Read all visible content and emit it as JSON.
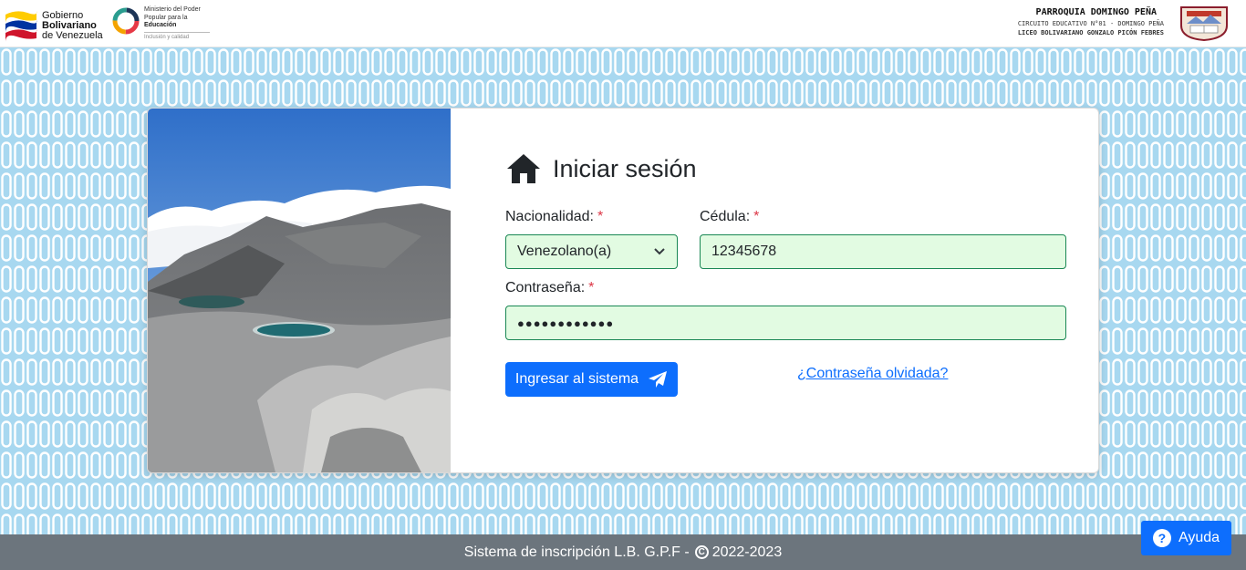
{
  "header": {
    "gov_logo": {
      "line1": "Gobierno",
      "line2": "Bolivariano",
      "line3": "de Venezuela",
      "flag_colors": [
        "#ffcc00",
        "#0033a0",
        "#cf142b"
      ]
    },
    "ministry_logo": {
      "line1": "Ministerio del Poder",
      "line2": "Popular para la",
      "line3": "Educación",
      "tagline": "Inclusión y calidad"
    },
    "school": {
      "parroquia": "PARROQUIA DOMINGO PEÑA",
      "circuito": "CIRCUITO EDUCATIVO N°01 - DOMINGO PEÑA",
      "liceo": "LICEO BOLIVARIANO GONZALO PICÓN FEBRES",
      "crest_icon": "school-crest-icon"
    }
  },
  "login": {
    "title": "Iniciar sesión",
    "title_icon": "home-icon",
    "nacionalidad": {
      "label": "Nacionalidad:",
      "required_mark": "*",
      "selected": "Venezolano(a)"
    },
    "cedula": {
      "label": "Cédula:",
      "required_mark": "*",
      "value": "12345678"
    },
    "password": {
      "label": "Contraseña:",
      "required_mark": "*",
      "value": "●●●●●●●●●●●●"
    },
    "submit_label": "Ingresar al sistema",
    "submit_icon": "paper-plane-icon",
    "forgot_label": "¿Contraseña olvidada?"
  },
  "footer": {
    "text_prefix": "Sistema de inscripción L.B. G.P.F -",
    "copyright_symbol": "C",
    "years": "2022-2023"
  },
  "help": {
    "label": "Ayuda",
    "icon_glyph": "?"
  },
  "colors": {
    "primary": "#0d6efd",
    "valid_border": "#198754",
    "valid_bg": "#e2fbe2",
    "required": "#dc3545",
    "footer_bg": "#6c757d",
    "pattern_bg": "#a8d8f0"
  }
}
